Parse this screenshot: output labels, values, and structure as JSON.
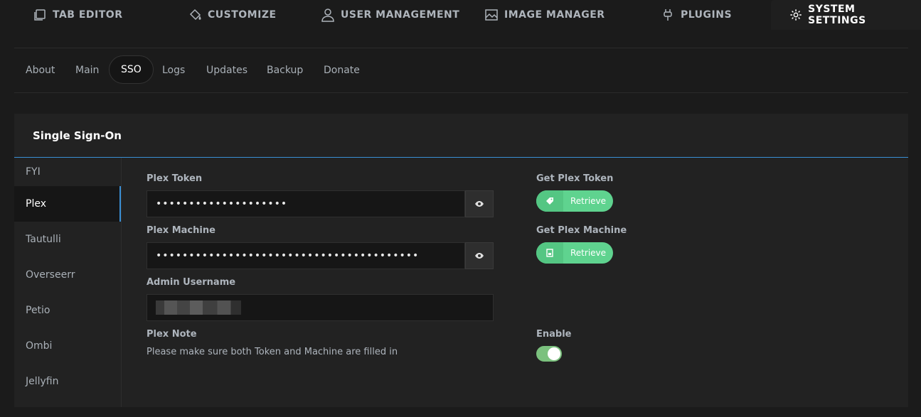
{
  "topnav": {
    "tabs": [
      {
        "label": "TAB EDITOR",
        "icon": "tab-editor-icon"
      },
      {
        "label": "CUSTOMIZE",
        "icon": "paint-bucket-icon"
      },
      {
        "label": "USER MANAGEMENT",
        "icon": "user-icon"
      },
      {
        "label": "IMAGE MANAGER",
        "icon": "image-icon"
      },
      {
        "label": "PLUGINS",
        "icon": "plug-icon"
      },
      {
        "label": "SYSTEM SETTINGS",
        "icon": "gear-icon"
      }
    ]
  },
  "subnav": {
    "items": [
      "About",
      "Main",
      "SSO",
      "Logs",
      "Updates",
      "Backup",
      "Donate"
    ],
    "active": "SSO"
  },
  "panel": {
    "title": "Single Sign-On",
    "sidebar": [
      "FYI",
      "Plex",
      "Tautulli",
      "Overseerr",
      "Petio",
      "Ombi",
      "Jellyfin"
    ],
    "active_sidebar": "Plex",
    "accent_color": "#3a8fd6",
    "fields": {
      "plex_token": {
        "label": "Plex Token",
        "value": "••••••••••••••••••••"
      },
      "plex_machine": {
        "label": "Plex Machine",
        "value": "••••••••••••••••••••••••••••••••••••••••"
      },
      "admin_username": {
        "label": "Admin Username",
        "value": ""
      },
      "plex_note": {
        "label": "Plex Note",
        "text": "Please make sure both Token and Machine are filled in"
      }
    },
    "right": {
      "get_token": {
        "label": "Get Plex Token",
        "button": "Retrieve",
        "icon": "ticket-icon"
      },
      "get_machine": {
        "label": "Get Plex Machine",
        "button": "Retrieve",
        "icon": "server-icon"
      },
      "enable": {
        "label": "Enable",
        "on": true
      }
    },
    "button_color": "#5fd38f",
    "toggle_color": "#7bc17e"
  }
}
